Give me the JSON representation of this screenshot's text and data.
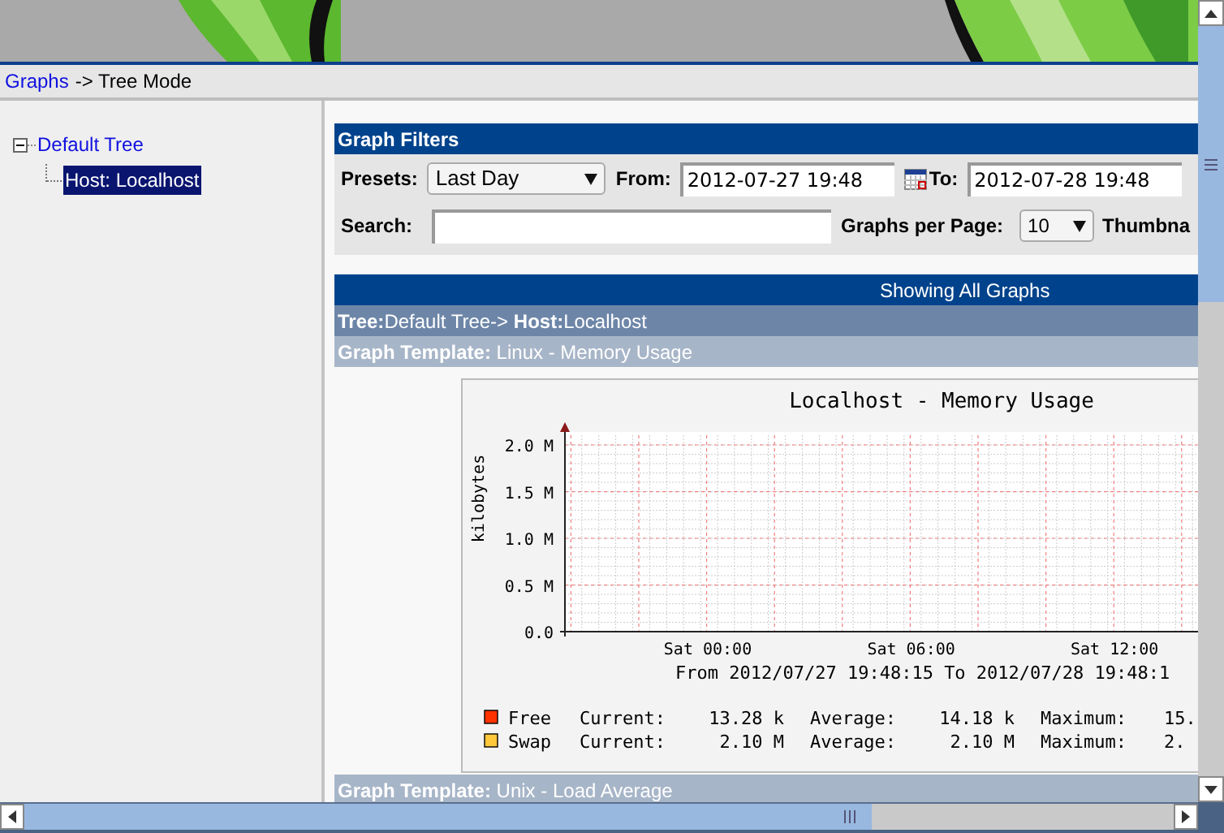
{
  "breadcrumb": {
    "link": "Graphs",
    "rest": "-> Tree Mode"
  },
  "tree": [
    {
      "label": "Default Tree",
      "expanded": true,
      "selected": false,
      "children": [
        {
          "label": "Host: Localhost",
          "selected": true
        }
      ]
    }
  ],
  "filters": {
    "title": "Graph Filters",
    "presets_label": "Presets:",
    "preset": "Last Day",
    "from_label": "From:",
    "from": "2012-07-27 19:48",
    "to_label": "To:",
    "to": "2012-07-28 19:48",
    "search_label": "Search:",
    "per_page_label": "Graphs per Page:",
    "per_page": "10",
    "thumbnails_label": "Thumbna"
  },
  "showing": "Showing All Graphs",
  "path": [
    {
      "label": "Tree:",
      "text": "Default Tree->"
    },
    {
      "label": "Host:",
      "text": "Localhost"
    }
  ],
  "templates": [
    {
      "header": {
        "label": "Graph Template:",
        "text": "Linux - Memory Usage"
      },
      "graph": {
        "chart_data": {
          "type": "line",
          "title": "Localhost - Memory Usage",
          "ylabel": "kilobytes",
          "x": [
            "Sat 00:00",
            "Sat 06:00",
            "Sat 12:00"
          ],
          "grid": true,
          "ylim": [
            0,
            2000000
          ],
          "yticks": [
            {
              "value": 0,
              "label": "0.0"
            },
            {
              "value": 500000,
              "label": "0.5 M"
            },
            {
              "value": 1000000,
              "label": "1.0 M"
            },
            {
              "value": 1500000,
              "label": "1.5 M"
            },
            {
              "value": 2000000,
              "label": "2.0 M"
            }
          ],
          "series": [
            {
              "name": "Free",
              "color": "#ff3300",
              "values": [
                null,
                null,
                null
              ]
            },
            {
              "name": "Swap",
              "color": "#ffc73b",
              "values": [
                null,
                null,
                null
              ]
            }
          ]
        },
        "range": "From 2012/07/27 19:48:15 To 2012/07/28 19:48:1",
        "legend": [
          {
            "current_label": "Current:",
            "current": "13.28 k",
            "average_label": "Average:",
            "average": "14.18 k",
            "maximum_label": "Maximum:",
            "maximum": "15."
          },
          {
            "current_label": "Current:",
            "current": "2.10 M",
            "average_label": "Average:",
            "average": "2.10 M",
            "maximum_label": "Maximum:",
            "maximum": "2."
          }
        ]
      }
    },
    {
      "header": {
        "label": "Graph Template:",
        "text": "Unix - Load Average"
      }
    }
  ]
}
